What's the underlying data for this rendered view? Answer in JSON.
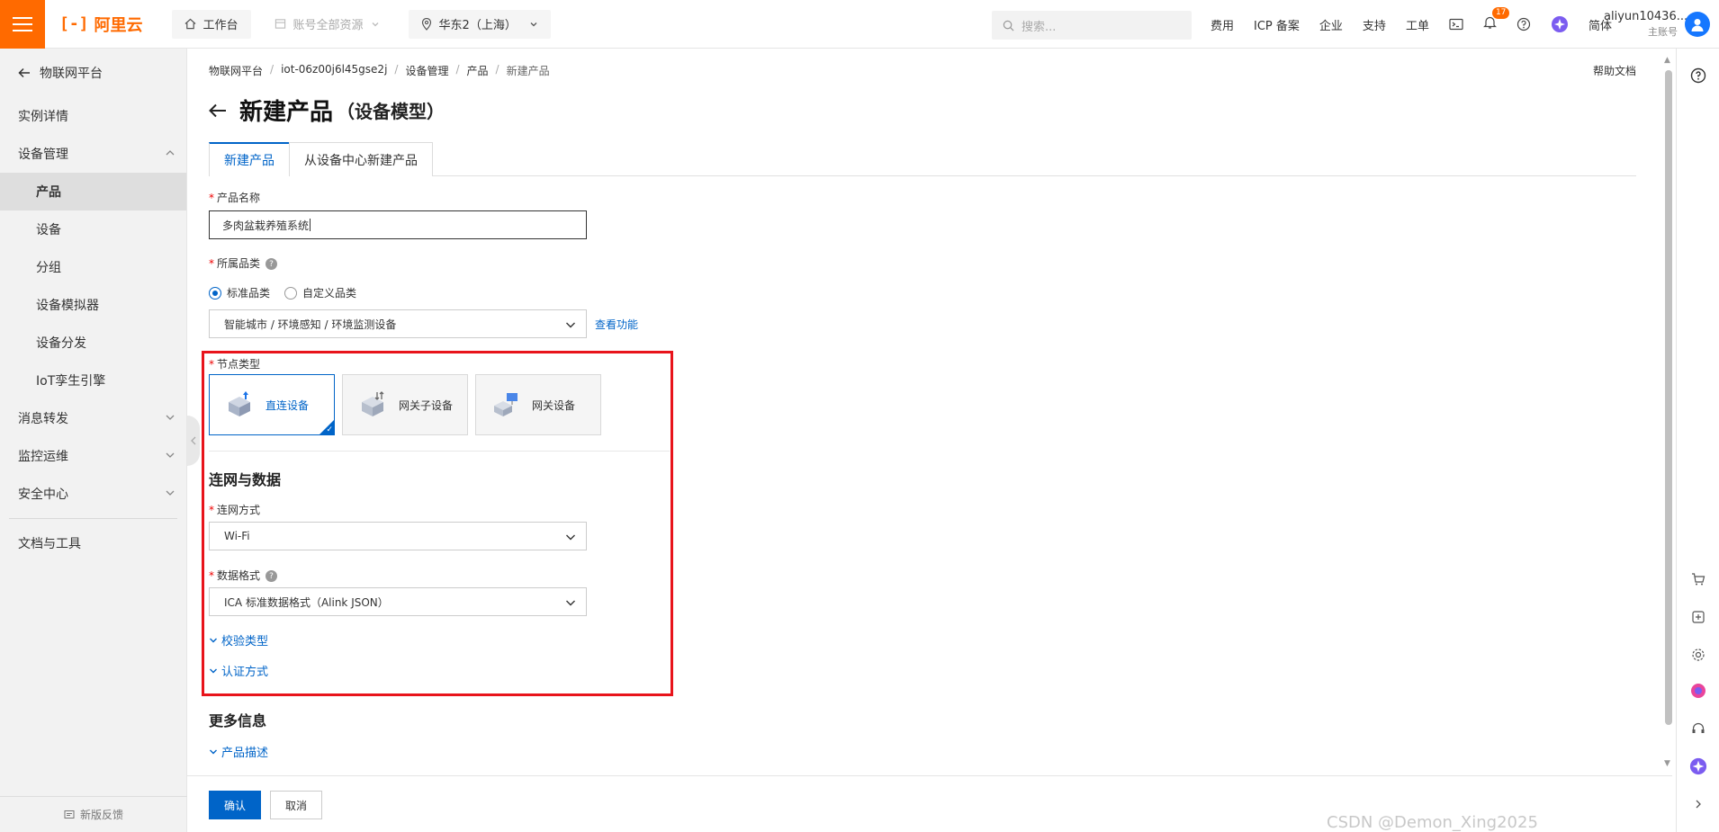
{
  "topbar": {
    "logo_text": "阿里云",
    "workbench": "工作台",
    "resource_scope": "账号全部资源",
    "region": "华东2（上海）",
    "search_placeholder": "搜索...",
    "links": [
      "费用",
      "ICP 备案",
      "企业",
      "支持",
      "工单"
    ],
    "notification_count": "17",
    "language": "简体",
    "account_name": "aliyun10436...",
    "account_type": "主账号"
  },
  "sidebar": {
    "back_label": "物联网平台",
    "items": [
      {
        "label": "实例详情"
      },
      {
        "label": "设备管理"
      },
      {
        "label": "产品"
      },
      {
        "label": "设备"
      },
      {
        "label": "分组"
      },
      {
        "label": "设备模拟器"
      },
      {
        "label": "设备分发"
      },
      {
        "label": "IoT孪生引擎"
      },
      {
        "label": "消息转发"
      },
      {
        "label": "监控运维"
      },
      {
        "label": "安全中心"
      },
      {
        "label": "文档与工具"
      }
    ],
    "feedback": "新版反馈"
  },
  "breadcrumb": [
    "物联网平台",
    "iot-06z00j6l45gse2j",
    "设备管理",
    "产品",
    "新建产品"
  ],
  "help_doc": "帮助文档",
  "page": {
    "title": "新建产品",
    "subtitle": "（设备模型）"
  },
  "tabs": [
    "新建产品",
    "从设备中心新建产品"
  ],
  "form": {
    "product_name_label": "产品名称",
    "product_name_value": "多肉盆栽养殖系统",
    "category_label": "所属品类",
    "category_standard": "标准品类",
    "category_custom": "自定义品类",
    "category_value": "智能城市 / 环境感知 / 环境监测设备",
    "view_features": "查看功能",
    "node_type_label": "节点类型",
    "node_types": [
      "直连设备",
      "网关子设备",
      "网关设备"
    ],
    "network_section": "连网与数据",
    "network_method_label": "连网方式",
    "network_method_value": "Wi-Fi",
    "data_format_label": "数据格式",
    "data_format_value": "ICA 标准数据格式（Alink JSON）",
    "check_type": "校验类型",
    "auth_method": "认证方式",
    "more_info": "更多信息",
    "product_desc": "产品描述"
  },
  "actions": {
    "confirm": "确认",
    "cancel": "取消"
  },
  "watermark": "CSDN @Demon_Xing2025",
  "colors": {
    "brand": "#ff6a00",
    "primary": "#0064c8",
    "highlight_box": "#e8141b"
  }
}
